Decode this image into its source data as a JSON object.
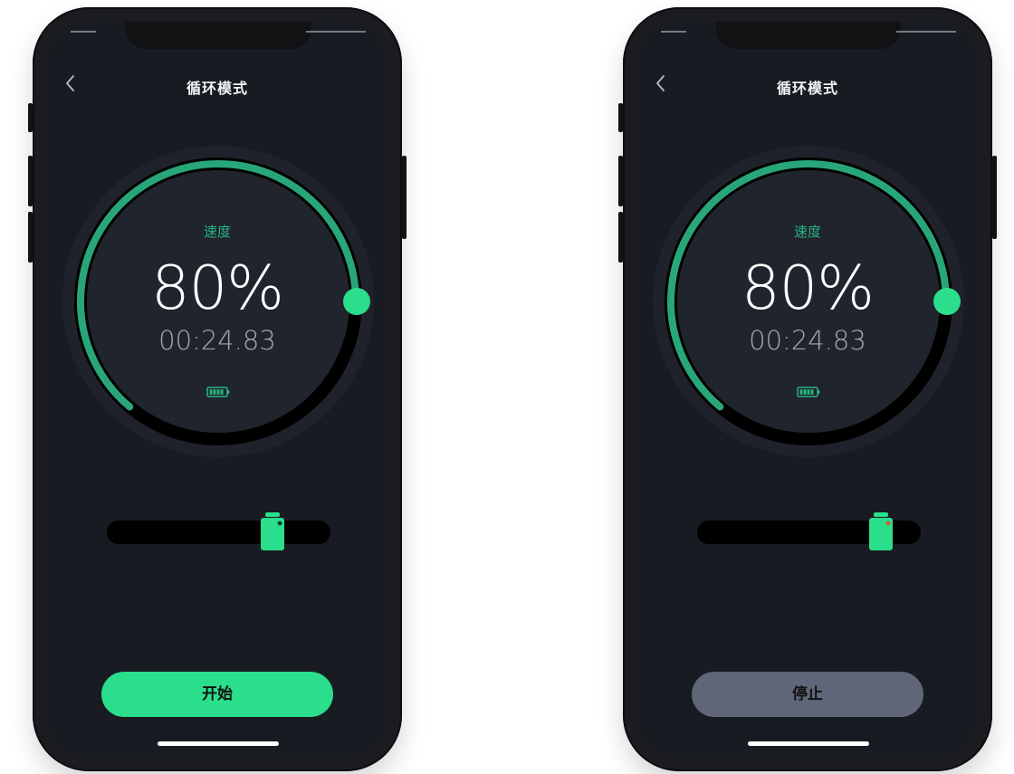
{
  "screens": [
    {
      "title": "循环模式",
      "speed_label": "速度",
      "speed_value": "80%",
      "speed_percent": 80,
      "timer": "00:24.83",
      "slider_level": 0.74,
      "thumb_variant": "ready",
      "button_label": "开始",
      "button_color": "#2bde8b"
    },
    {
      "title": "循环模式",
      "speed_label": "速度",
      "speed_value": "80%",
      "speed_percent": 80,
      "timer": "00:24.83",
      "slider_level": 0.82,
      "thumb_variant": "active",
      "button_label": "停止",
      "button_color": "#5f6678"
    }
  ],
  "colors": {
    "screen_background": "#181b22",
    "gauge_outer_background": "#1f222a",
    "gauge_inner_background": "#20242d",
    "gauge_track": "#000000",
    "gauge_progress": "#28a67a",
    "gauge_knob": "#2bde8b",
    "speed_label": "#28b37f",
    "timer": "#a1a8b5",
    "slider_track": "#000000",
    "slider_thumb": "#2bde8b",
    "slider_thumb_dot": "#0f3d2f",
    "slider_thumb_dot_active": "#d65a33"
  },
  "icons": {
    "back": "chevron-left-icon",
    "battery": "battery-icon"
  }
}
